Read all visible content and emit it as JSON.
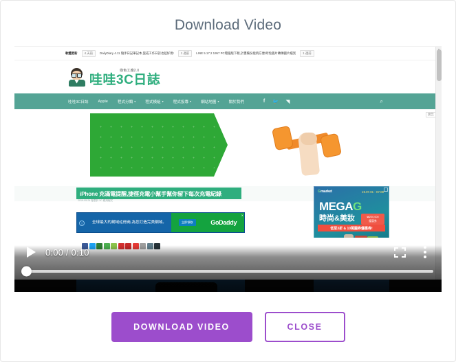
{
  "modal": {
    "title": "Download Video",
    "buttons": {
      "primary": "DOWNLOAD VIDEO",
      "secondary": "CLOSE"
    },
    "accent_color": "#9c4dcc",
    "title_color": "#5c6b7a"
  },
  "player": {
    "current_time": "0:00",
    "duration": "0:10",
    "time_display": "0:00 / 0:10",
    "play_icon": "play-triangle-icon",
    "fullscreen_icon": "fullscreen-icon",
    "more_icon": "kebab-menu-icon",
    "progress_percent": 0
  },
  "video_page": {
    "ticker": {
      "label": "軟體更新",
      "pill1": "4 天前",
      "item1": "DailyDiary 4.11 隨手日記筆記本,當成工作日誌也超好用!",
      "pill2": "1 週前",
      "item2": "LINE 5.17.2 1957 PC電腦版下載,計畫備份能夠方便!跨免圖片轉傳圖片檔案",
      "pill3": "1 週前"
    },
    "logo": {
      "sub": "綠色工廠2.0",
      "main": "哇哇3C日誌",
      "avatar_icon": "avatar-icon"
    },
    "nav": {
      "items": [
        {
          "label": "哇哇3C日誌",
          "caret": false
        },
        {
          "label": "Apple",
          "caret": false
        },
        {
          "label": "程式分類",
          "caret": true
        },
        {
          "label": "程式模組",
          "caret": true
        },
        {
          "label": "程式投專",
          "caret": true
        },
        {
          "label": "網站地圖",
          "caret": true
        },
        {
          "label": "關於我們",
          "caret": false
        }
      ],
      "social": [
        {
          "glyph": "f",
          "name": "facebook-icon"
        },
        {
          "glyph": "🐦",
          "name": "twitter-icon"
        },
        {
          "glyph": "◥",
          "name": "rss-icon"
        }
      ],
      "search_icon": "search-icon",
      "bar_color": "#54a495"
    },
    "hero": {
      "badge": "廣告",
      "green_color": "#2ea836",
      "dumbbell_color": "#f5962f"
    },
    "article": {
      "title": "iPhone 充滿電提醒,捷徑充電小幫手幫你留下每次充電紀錄",
      "meta": "2019-05-24 發表於 3C 應用程式"
    },
    "godaddy_ad": {
      "line1": "全球最大的網域註冊商,",
      "line2": "為您打造完美網域。",
      "cta": "立即領取",
      "brand": "GoDaddy",
      "close_icon": "close-icon"
    },
    "mega_ad": {
      "brand_g": "G",
      "brand_rest": "market",
      "date": "19.07.01\n- 07.08",
      "title_mega": "MEGA",
      "title_g": "G",
      "subtitle": "時尚&美妝",
      "coupon_amount": "₩200,000",
      "coupon_label": "優惠券",
      "strip": "低至3折 & 10萬圓券優惠券!",
      "close_icon": "close-icon"
    },
    "share_chips": [
      "#3b5998",
      "#1da1f2",
      "#2e7d32",
      "#4caf50",
      "#8bc34a",
      "#d32f2f",
      "#c62828",
      "#e53935",
      "#9e9e9e",
      "#607d8b",
      "#263238"
    ],
    "scrollbar": {
      "arrow": "▲"
    }
  }
}
